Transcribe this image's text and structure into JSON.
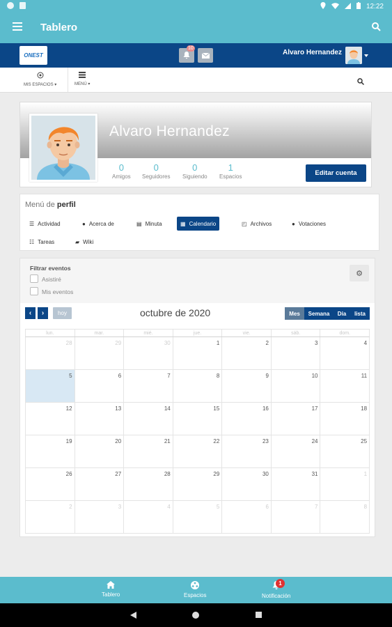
{
  "status_bar": {
    "time": "12:22"
  },
  "app_bar": {
    "title": "Tablero"
  },
  "site_header": {
    "logo_text": "ONEST",
    "notification_count": "10",
    "user_name": "Alvaro Hernandez"
  },
  "sub_nav": {
    "spaces_label": "MIS ESPACIOS",
    "menu_label": "MENÚ"
  },
  "profile": {
    "name": "Alvaro Hernandez",
    "stats": [
      {
        "value": "0",
        "label": "Amigos"
      },
      {
        "value": "0",
        "label": "Seguidores"
      },
      {
        "value": "0",
        "label": "Siguiendo"
      },
      {
        "value": "1",
        "label": "Espacios"
      }
    ],
    "edit_button": "Editar cuenta"
  },
  "profile_menu": {
    "title_prefix": "Menú de",
    "title_bold": "perfil",
    "tabs": [
      {
        "label": "Actividad",
        "icon": "list-icon"
      },
      {
        "label": "Acerca de",
        "icon": "info-icon"
      },
      {
        "label": "Minuta",
        "icon": "keyboard-icon"
      },
      {
        "label": "Calendario",
        "icon": "calendar-icon"
      },
      {
        "label": "Archivos",
        "icon": "files-icon"
      },
      {
        "label": "Votaciones",
        "icon": "question-icon"
      },
      {
        "label": "Tareas",
        "icon": "tasks-icon"
      },
      {
        "label": "Wiki",
        "icon": "book-icon"
      }
    ]
  },
  "calendar": {
    "filter_title": "Filtrar eventos",
    "filters": [
      "Asistiré",
      "Mis eventos"
    ],
    "today_button": "hoy",
    "month_title": "octubre de 2020",
    "views": [
      "Mes",
      "Semana",
      "Día",
      "lista"
    ],
    "active_view": "Mes",
    "weekdays": [
      "lun.",
      "mar.",
      "mié.",
      "jue.",
      "vie.",
      "sáb.",
      "dom."
    ],
    "weeks": [
      [
        "28",
        "29",
        "30",
        "1",
        "2",
        "3",
        "4"
      ],
      [
        "5",
        "6",
        "7",
        "8",
        "9",
        "10",
        "11"
      ],
      [
        "12",
        "13",
        "14",
        "15",
        "16",
        "17",
        "18"
      ],
      [
        "19",
        "20",
        "21",
        "22",
        "23",
        "24",
        "25"
      ],
      [
        "26",
        "27",
        "28",
        "29",
        "30",
        "31",
        "1"
      ],
      [
        "2",
        "3",
        "4",
        "5",
        "6",
        "7",
        "8"
      ]
    ],
    "today": "5"
  },
  "bottom_nav": {
    "items": [
      {
        "label": "Tablero",
        "icon": "home-icon"
      },
      {
        "label": "Espacios",
        "icon": "spaces-icon"
      },
      {
        "label": "Notificación",
        "icon": "bell-icon",
        "badge": "1"
      }
    ]
  },
  "colors": {
    "teal": "#5bbccd",
    "navy": "#0b4687",
    "today_cell": "#d8e8f4"
  }
}
